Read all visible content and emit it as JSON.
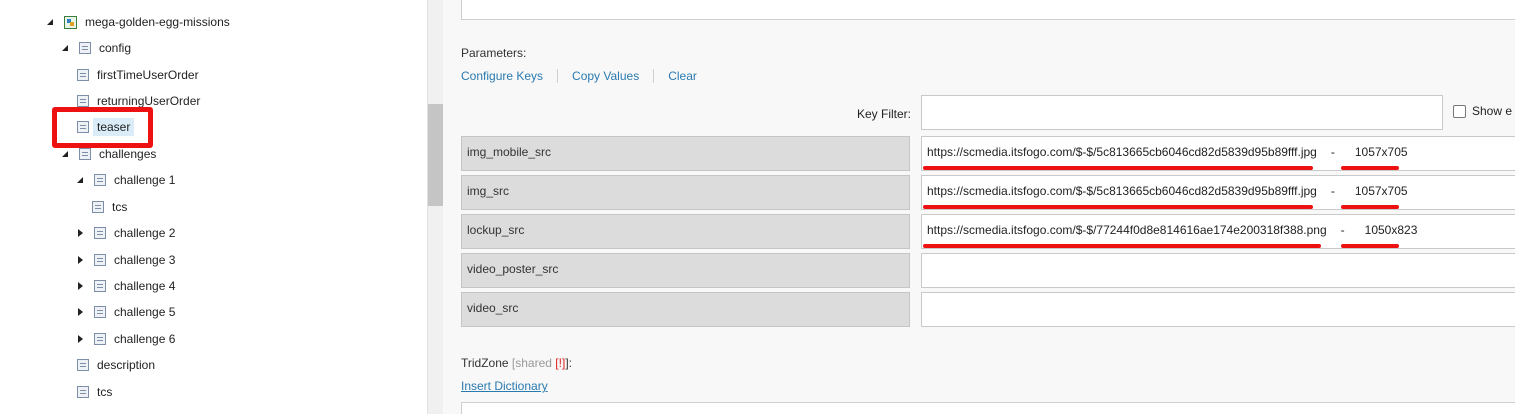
{
  "tree": {
    "items": [
      {
        "label": "mega-golden-egg-missions",
        "icon": "module-icon",
        "state": "open"
      },
      {
        "label": "config",
        "icon": "document-icon",
        "state": "open"
      },
      {
        "label": "firstTimeUserOrder",
        "icon": "document-icon",
        "state": "none"
      },
      {
        "label": "returningUserOrder",
        "icon": "document-icon",
        "state": "none"
      },
      {
        "label": "teaser",
        "icon": "document-icon",
        "state": "none",
        "selected": true
      },
      {
        "label": "challenges",
        "icon": "document-icon",
        "state": "open"
      },
      {
        "label": "challenge 1",
        "icon": "document-icon",
        "state": "open"
      },
      {
        "label": "tcs",
        "icon": "document-icon",
        "state": "none"
      },
      {
        "label": "challenge 2",
        "icon": "document-icon",
        "state": "closed"
      },
      {
        "label": "challenge 3",
        "icon": "document-icon",
        "state": "closed"
      },
      {
        "label": "challenge 4",
        "icon": "document-icon",
        "state": "closed"
      },
      {
        "label": "challenge 5",
        "icon": "document-icon",
        "state": "closed"
      },
      {
        "label": "challenge 6",
        "icon": "document-icon",
        "state": "closed"
      },
      {
        "label": "description",
        "icon": "document-icon",
        "state": "none"
      },
      {
        "label": "tcs",
        "icon": "document-icon",
        "state": "none"
      }
    ]
  },
  "parameters": {
    "title": "Parameters:",
    "links": {
      "configure": "Configure Keys",
      "copy": "Copy Values",
      "clear": "Clear"
    },
    "key_filter_label": "Key Filter:",
    "key_filter_value": "",
    "show_empty_label": "Show e",
    "rows": [
      {
        "key": "img_mobile_src",
        "url": "https://scmedia.itsfogo.com/$-$/5c813665cb6046cd82d5839d95b89fff.jpg",
        "dash": "-",
        "dims": "1057x705"
      },
      {
        "key": "img_src",
        "url": "https://scmedia.itsfogo.com/$-$/5c813665cb6046cd82d5839d95b89fff.jpg",
        "dash": "-",
        "dims": "1057x705"
      },
      {
        "key": "lockup_src",
        "url": "https://scmedia.itsfogo.com/$-$/77244f0d8e814616ae174e200318f388.png",
        "dash": "-",
        "dims": "1050x823"
      },
      {
        "key": "video_poster_src",
        "url": "",
        "dash": "",
        "dims": ""
      },
      {
        "key": "video_src",
        "url": "",
        "dash": "",
        "dims": ""
      }
    ]
  },
  "tridzone": {
    "title": "TridZone",
    "shared": "[shared",
    "bang": "[!]",
    "suffix": "]:",
    "insert_link": "Insert Dictionary"
  },
  "colors": {
    "annotation": "#ee1111",
    "link": "#2a7ab0",
    "selected": "#d9ecf7"
  }
}
